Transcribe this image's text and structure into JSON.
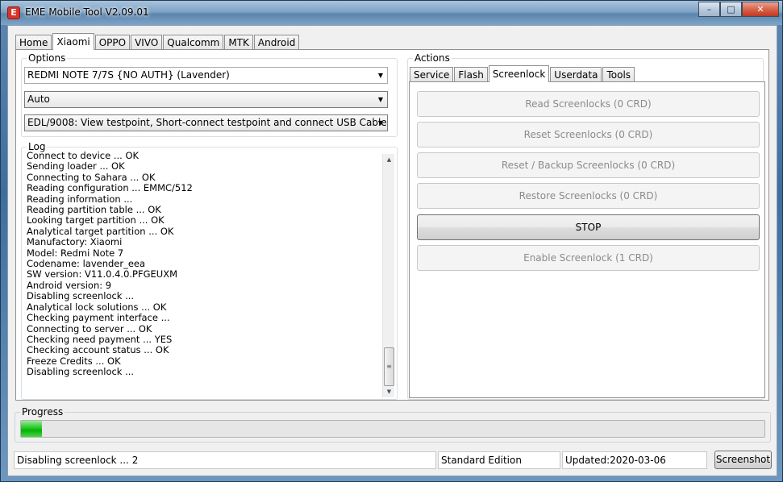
{
  "window": {
    "title": "EME Mobile Tool V2.09.01",
    "app_icon_glyph": "E",
    "minimize": "–",
    "maximize": "□",
    "close": "✕"
  },
  "main_tabs": [
    "Home",
    "Xiaomi",
    "OPPO",
    "VIVO",
    "Qualcomm",
    "MTK",
    "Android"
  ],
  "options": {
    "label": "Options",
    "model": "REDMI NOTE 7/7S {NO AUTH} (Lavender)",
    "mode": "Auto",
    "connection": "EDL/9008: View testpoint, Short-connect testpoint and connect USB Cable"
  },
  "log": {
    "label": "Log",
    "lines": [
      "Connect to device ... OK",
      "Sending loader ... OK",
      "Connecting to Sahara ... OK",
      "Reading configuration ... EMMC/512",
      "Reading information ...",
      "Reading partition table ... OK",
      "Looking target partition ... OK",
      "Analytical target partition ... OK",
      "Manufactory: Xiaomi",
      "Model: Redmi Note 7",
      "Codename: lavender_eea",
      "SW version: V11.0.4.0.PFGEUXM",
      "Android version: 9",
      "Disabling screenlock ...",
      "Analytical lock solutions ... OK",
      "Checking payment interface ...",
      "Connecting to server ... OK",
      "Checking need payment ... YES",
      "Checking account status ... OK",
      "Freeze Credits ... OK",
      "Disabling screenlock ..."
    ]
  },
  "actions": {
    "label": "Actions",
    "tabs": [
      "Service",
      "Flash",
      "Screenlock",
      "Userdata",
      "Tools"
    ],
    "buttons": [
      {
        "label": "Read Screenlocks (0 CRD)",
        "enabled": false
      },
      {
        "label": "Reset Screenlocks (0 CRD)",
        "enabled": false
      },
      {
        "label": "Reset / Backup Screenlocks (0 CRD)",
        "enabled": false
      },
      {
        "label": "Restore Screenlocks (0 CRD)",
        "enabled": false
      },
      {
        "label": "STOP",
        "enabled": true
      },
      {
        "label": "Enable Screenlock (1 CRD)",
        "enabled": false
      }
    ]
  },
  "progress": {
    "label": "Progress",
    "value_fraction": 0.028
  },
  "status": {
    "message": "Disabling screenlock ... 2",
    "edition": "Standard Edition",
    "updated": "Updated:2020-03-06",
    "screenshot_button": "Screenshot"
  },
  "colors": {
    "progress_fill": "#06b006",
    "disabled_text": "#8b8b8b"
  }
}
